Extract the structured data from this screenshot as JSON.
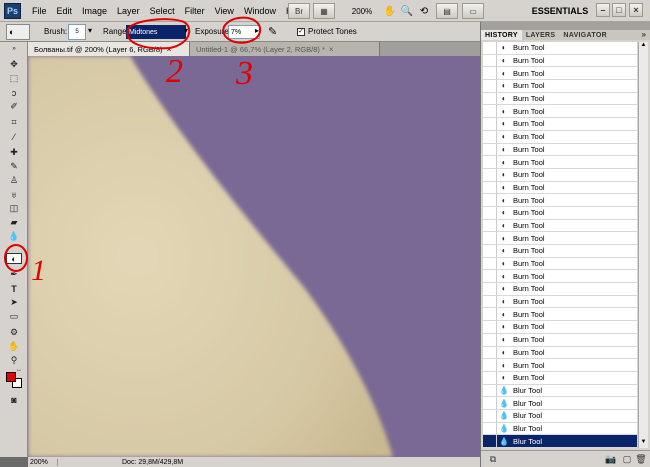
{
  "app": {
    "logo": "Ps"
  },
  "menu": [
    "File",
    "Edit",
    "Image",
    "Layer",
    "Select",
    "Filter",
    "View",
    "Window",
    "Help"
  ],
  "menubar_right": {
    "zoom": "200%",
    "workspace": "ESSENTIALS",
    "min": "–",
    "max": "□",
    "close": "×"
  },
  "options": {
    "brush_label": "Brush:",
    "brush_size": "5",
    "range_label": "Range:",
    "range_value": "Midtones",
    "exposure_label": "Exposure:",
    "exposure_value": "7%",
    "protect_label": "Protect Tones",
    "protect_checked": "✓"
  },
  "tabs": [
    {
      "title": "Болваны.tif @ 200% (Layer 6, RGB/8)",
      "close": "×"
    },
    {
      "title": "Untitled-1 @ 66,7% (Layer 2, RGB/8) *",
      "close": "×"
    }
  ],
  "status": {
    "zoom": "200%",
    "doc": "Doc: 29,8M/429,8M"
  },
  "panel": {
    "tabs": [
      "HISTORY",
      "LAYERS",
      "NAVIGATOR"
    ],
    "menu_icon": "»",
    "history": [
      {
        "icon": "burn-icon",
        "label": "Burn Tool"
      },
      {
        "icon": "burn-icon",
        "label": "Burn Tool"
      },
      {
        "icon": "burn-icon",
        "label": "Burn Tool"
      },
      {
        "icon": "burn-icon",
        "label": "Burn Tool"
      },
      {
        "icon": "burn-icon",
        "label": "Burn Tool"
      },
      {
        "icon": "burn-icon",
        "label": "Burn Tool"
      },
      {
        "icon": "burn-icon",
        "label": "Burn Tool"
      },
      {
        "icon": "burn-icon",
        "label": "Burn Tool"
      },
      {
        "icon": "burn-icon",
        "label": "Burn Tool"
      },
      {
        "icon": "burn-icon",
        "label": "Burn Tool"
      },
      {
        "icon": "burn-icon",
        "label": "Burn Tool"
      },
      {
        "icon": "burn-icon",
        "label": "Burn Tool"
      },
      {
        "icon": "burn-icon",
        "label": "Burn Tool"
      },
      {
        "icon": "burn-icon",
        "label": "Burn Tool"
      },
      {
        "icon": "burn-icon",
        "label": "Burn Tool"
      },
      {
        "icon": "burn-icon",
        "label": "Burn Tool"
      },
      {
        "icon": "burn-icon",
        "label": "Burn Tool"
      },
      {
        "icon": "burn-icon",
        "label": "Burn Tool"
      },
      {
        "icon": "burn-icon",
        "label": "Burn Tool"
      },
      {
        "icon": "burn-icon",
        "label": "Burn Tool"
      },
      {
        "icon": "burn-icon",
        "label": "Burn Tool"
      },
      {
        "icon": "burn-icon",
        "label": "Burn Tool"
      },
      {
        "icon": "burn-icon",
        "label": "Burn Tool"
      },
      {
        "icon": "burn-icon",
        "label": "Burn Tool"
      },
      {
        "icon": "burn-icon",
        "label": "Burn Tool"
      },
      {
        "icon": "burn-icon",
        "label": "Burn Tool"
      },
      {
        "icon": "burn-icon",
        "label": "Burn Tool"
      },
      {
        "icon": "blur-icon",
        "label": "Blur Tool"
      },
      {
        "icon": "blur-icon",
        "label": "Blur Tool"
      },
      {
        "icon": "blur-icon",
        "label": "Blur Tool"
      },
      {
        "icon": "blur-icon",
        "label": "Blur Tool"
      },
      {
        "icon": "blur-icon",
        "label": "Blur Tool"
      }
    ]
  },
  "annotations": [
    "1",
    "2",
    "3"
  ],
  "colors": {
    "canvas_bg": "#7a6994",
    "skin": "#d8cbaa",
    "selection": "#0a246a",
    "annotation": "#e00000",
    "foreground": "#e60000"
  }
}
